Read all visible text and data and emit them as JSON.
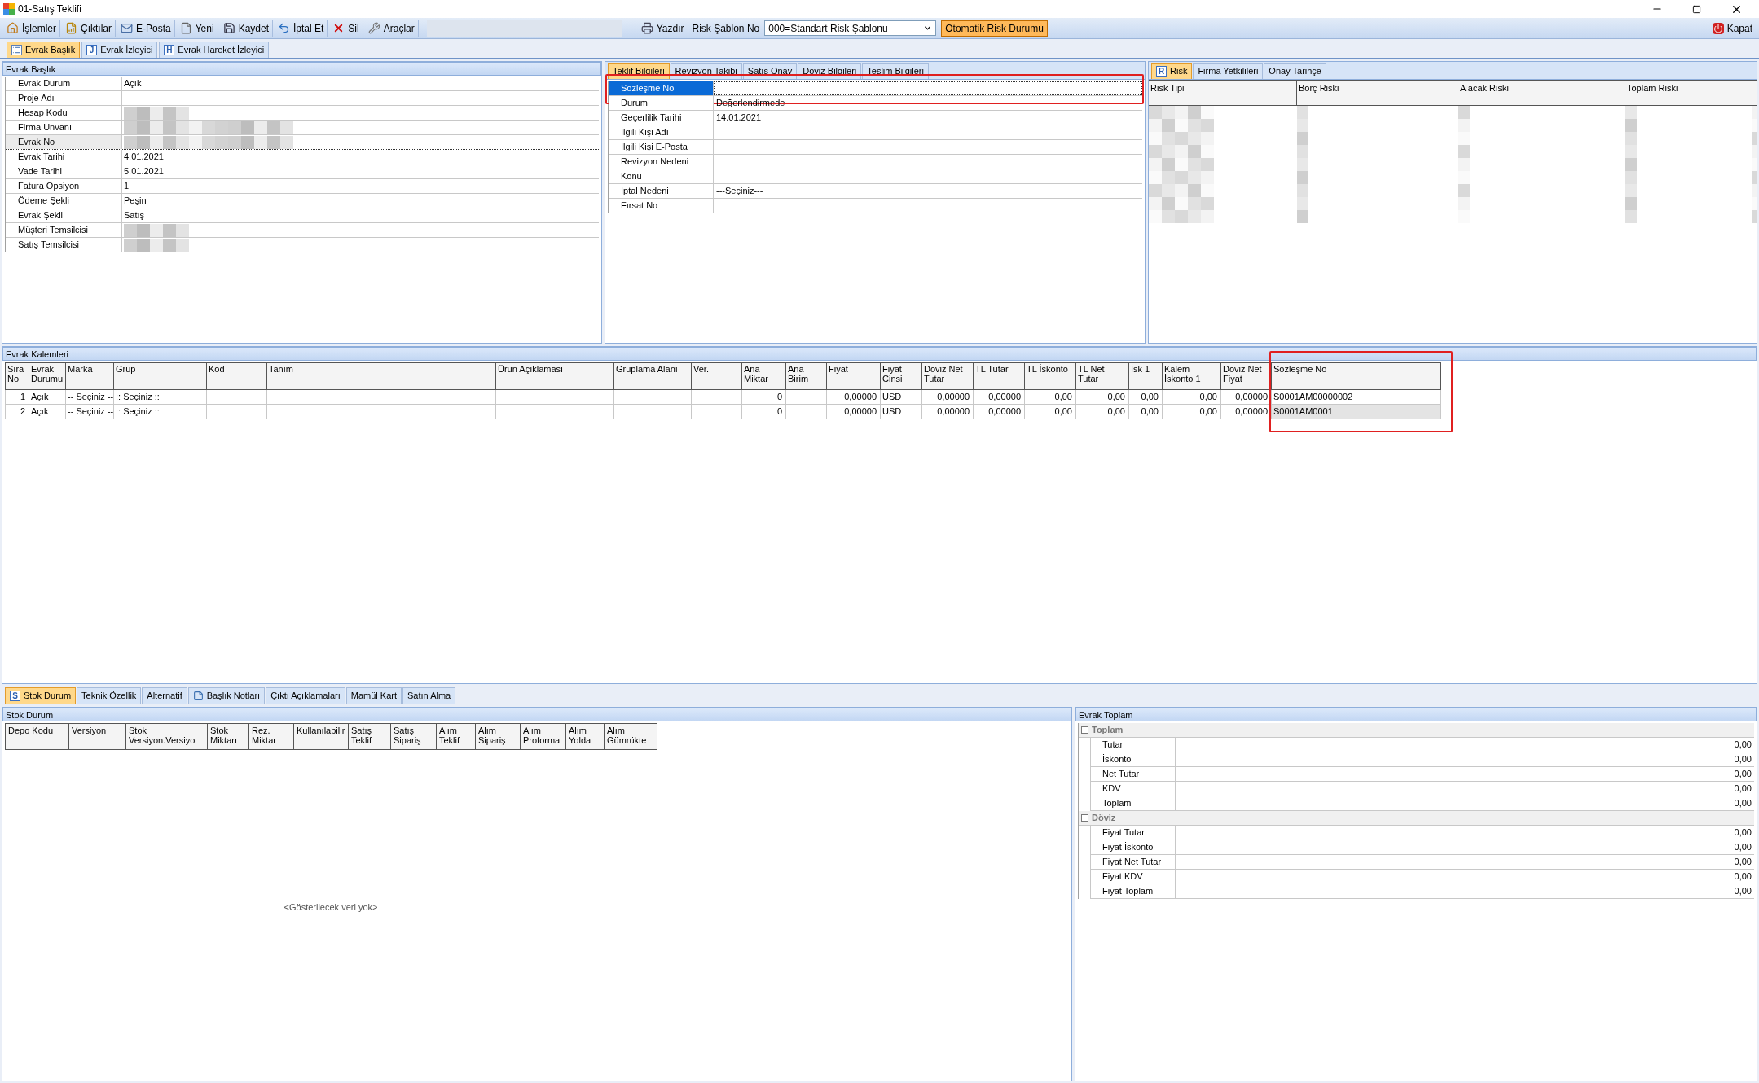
{
  "window": {
    "title": "01-Satış Teklifi"
  },
  "toolbar": {
    "items": [
      {
        "label": "İşlemler"
      },
      {
        "label": "Çıktılar"
      },
      {
        "label": "E-Posta"
      },
      {
        "label": "Yeni"
      },
      {
        "label": "Kaydet"
      },
      {
        "label": "İptal Et"
      },
      {
        "label": "Sil"
      },
      {
        "label": "Araçlar"
      }
    ],
    "print": {
      "label": "Yazdır"
    },
    "risk_template": {
      "label": "Risk Şablon No",
      "value": "000=Standart Risk Şablonu"
    },
    "auto_risk_button": "Otomatik Risk Durumu",
    "close_button": "Kapat"
  },
  "doc_tabs": [
    {
      "label": "Evrak Başlık",
      "selected": true
    },
    {
      "label": "Evrak İzleyici",
      "selected": false,
      "badge": "J"
    },
    {
      "label": "Evrak Hareket İzleyici",
      "selected": false,
      "badge": "H"
    }
  ],
  "header_panel": {
    "title": "Evrak Başlık",
    "fields": [
      {
        "label": "Evrak Durum",
        "value": "Açık",
        "focused": false,
        "redacted": false
      },
      {
        "label": "Proje Adı",
        "focused": false,
        "redacted": false
      },
      {
        "label": "Hesap Kodu",
        "focused": false,
        "redacted": true
      },
      {
        "label": "Firma Unvanı",
        "focused": false,
        "redacted": true
      },
      {
        "label": "Evrak No",
        "focused": true,
        "redacted": true
      },
      {
        "label": "Evrak Tarihi",
        "value": "4.01.2021",
        "focused": false,
        "redacted": false
      },
      {
        "label": "Vade Tarihi",
        "value": "5.01.2021",
        "focused": false,
        "redacted": false
      },
      {
        "label": "Fatura Opsiyon",
        "value": "1",
        "focused": false,
        "redacted": false
      },
      {
        "label": "Ödeme Şekli",
        "value": "Peşin",
        "focused": false,
        "redacted": false
      },
      {
        "label": "Evrak Şekli",
        "value": "Satış",
        "focused": false,
        "redacted": false
      },
      {
        "label": "Müşteri Temsilcisi",
        "focused": false,
        "redacted": true
      },
      {
        "label": "Satış Temsilcisi",
        "focused": false,
        "redacted": true
      }
    ]
  },
  "offer_tabs": [
    {
      "label": "Teklif Bilgileri",
      "selected": true
    },
    {
      "label": "Revizyon Takibi",
      "selected": false
    },
    {
      "label": "Satış Onay",
      "selected": false
    },
    {
      "label": "Döviz Bilgileri",
      "selected": false
    },
    {
      "label": "Teslim Bilgileri",
      "selected": false
    }
  ],
  "offer_fields": [
    {
      "label": "Sözleşme No",
      "selected": true,
      "highlighted": true
    },
    {
      "label": "Durum",
      "value": "Değerlendirmede",
      "selected": false
    },
    {
      "label": "Geçerlilik Tarihi",
      "value": "14.01.2021",
      "selected": false
    },
    {
      "label": "İlgili Kişi Adı",
      "selected": false
    },
    {
      "label": "İlgili Kişi E-Posta",
      "selected": false
    },
    {
      "label": "Revizyon Nedeni",
      "selected": false
    },
    {
      "label": "Konu",
      "selected": false
    },
    {
      "label": "İptal Nedeni",
      "value": "---Seçiniz---",
      "selected": false
    },
    {
      "label": "Fırsat No",
      "selected": false
    }
  ],
  "risk_tabs": [
    {
      "label": "Risk",
      "selected": true,
      "badge": "R"
    },
    {
      "label": "Firma Yetkilileri",
      "selected": false
    },
    {
      "label": "Onay Tarihçe",
      "selected": false
    }
  ],
  "risk_table": {
    "columns": [
      "Risk Tipi",
      "Borç Riski",
      "Alacak Riski",
      "Toplam Riski"
    ],
    "redacted": true
  },
  "lines": {
    "title": "Evrak Kalemleri",
    "columns": [
      {
        "label": "Sıra No"
      },
      {
        "label": "Evrak Durumu"
      },
      {
        "label": "Marka"
      },
      {
        "label": "Grup"
      },
      {
        "label": "Kod"
      },
      {
        "label": "Tanım"
      },
      {
        "label": "Ürün Açıklaması"
      },
      {
        "label": "Gruplama Alanı"
      },
      {
        "label": "Ver."
      },
      {
        "label": "Ana Miktar"
      },
      {
        "label": "Ana Birim"
      },
      {
        "label": "Fiyat"
      },
      {
        "label": "Fiyat Cinsi"
      },
      {
        "label": "Döviz Net Tutar"
      },
      {
        "label": "TL Tutar"
      },
      {
        "label": "TL İskonto"
      },
      {
        "label": "TL Net Tutar"
      },
      {
        "label": "İsk 1"
      },
      {
        "label": "Kalem İskonto 1"
      },
      {
        "label": "Döviz Net Fiyat"
      },
      {
        "label": "Sözleşme No",
        "highlighted": true
      }
    ],
    "rows": [
      {
        "cells": [
          "1",
          "Açık",
          "-- Seçiniz --",
          ":: Seçiniz ::",
          "",
          "",
          "",
          "",
          "",
          "0",
          "",
          "0,00000",
          "USD",
          "0,00000",
          "0,00000",
          "0,00",
          "0,00",
          "0,00",
          "0,00",
          "0,00000",
          "S0001AM00000002"
        ],
        "selected": false
      },
      {
        "cells": [
          "2",
          "Açık",
          "-- Seçiniz --",
          ":: Seçiniz ::",
          "",
          "",
          "",
          "",
          "",
          "0",
          "",
          "0,00000",
          "USD",
          "0,00000",
          "0,00000",
          "0,00",
          "0,00",
          "0,00",
          "0,00",
          "0,00000",
          "S0001AM0001"
        ],
        "selected": true
      }
    ]
  },
  "bottom_tabs": [
    {
      "label": "Stok Durum",
      "selected": true,
      "badge": "S"
    },
    {
      "label": "Teknik Özellik",
      "selected": false
    },
    {
      "label": "Alternatif",
      "selected": false
    },
    {
      "label": "Başlık Notları",
      "selected": false
    },
    {
      "label": "Çıktı Açıklamaları",
      "selected": false
    },
    {
      "label": "Mamül Kart",
      "selected": false
    },
    {
      "label": "Satın Alma",
      "selected": false
    }
  ],
  "stock_panel": {
    "title": "Stok Durum",
    "columns": [
      "Depo Kodu",
      "Versiyon",
      "Stok Versiyon.Versiyo",
      "Stok Miktarı",
      "Rez. Miktar",
      "Kullanılabilir",
      "Satış Teklif",
      "Satış Sipariş",
      "Alım Teklif",
      "Alım Sipariş",
      "Alım Proforma",
      "Alım Yolda",
      "Alım Gümrükte"
    ],
    "empty_text": "<Gösterilecek veri yok>"
  },
  "totals_panel": {
    "title": "Evrak Toplam",
    "groups": [
      {
        "label": "Toplam",
        "expanded": true,
        "items": [
          {
            "label": "Tutar",
            "value": "0,00"
          },
          {
            "label": "İskonto",
            "value": "0,00"
          },
          {
            "label": "Net Tutar",
            "value": "0,00"
          },
          {
            "label": "KDV",
            "value": "0,00"
          },
          {
            "label": "Toplam",
            "value": "0,00"
          }
        ]
      },
      {
        "label": "Döviz",
        "expanded": true,
        "items": [
          {
            "label": "Fiyat Tutar",
            "value": "0,00"
          },
          {
            "label": "Fiyat İskonto",
            "value": "0,00"
          },
          {
            "label": "Fiyat Net Tutar",
            "value": "0,00"
          },
          {
            "label": "Fiyat KDV",
            "value": "0,00"
          },
          {
            "label": "Fiyat Toplam",
            "value": "0,00"
          }
        ]
      }
    ]
  }
}
